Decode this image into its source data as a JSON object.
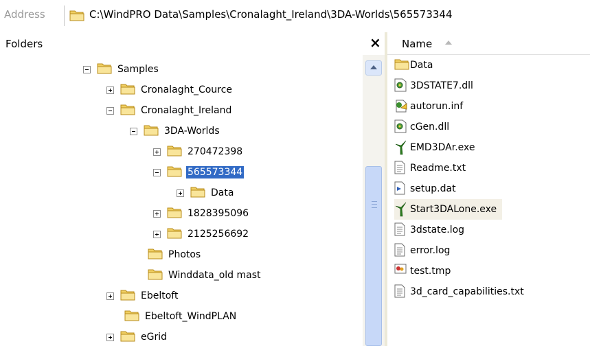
{
  "address": {
    "label": "Address",
    "path": "C:\\WindPRO Data\\Samples\\Cronalaght_Ireland\\3DA-Worlds\\565573344"
  },
  "folders_pane": {
    "title": "Folders",
    "close_glyph": "×"
  },
  "tree": {
    "samples": "Samples",
    "cronalaght_cource": "Cronalaght_Cource",
    "cronalaght_ireland": "Cronalaght_Ireland",
    "worlds": "3DA-Worlds",
    "n270": "270472398",
    "n565": "565573344",
    "data": "Data",
    "n1828": "1828395096",
    "n2125": "2125256692",
    "photos": "Photos",
    "winddata": "Winddata_old mast",
    "ebeltoft": "Ebeltoft",
    "ebeltoft_windplan": "Ebeltoft_WindPLAN",
    "egrid": "eGrid"
  },
  "list": {
    "column_name": "Name",
    "files": [
      {
        "name": "Data",
        "icon": "folder-icon"
      },
      {
        "name": "3DSTATE7.dll",
        "icon": "dll-icon"
      },
      {
        "name": "autorun.inf",
        "icon": "inf-icon"
      },
      {
        "name": "cGen.dll",
        "icon": "dll-icon"
      },
      {
        "name": "EMD3DAr.exe",
        "icon": "turbine-exe-icon"
      },
      {
        "name": "Readme.txt",
        "icon": "text-file-icon"
      },
      {
        "name": "setup.dat",
        "icon": "dat-file-icon"
      },
      {
        "name": "Start3DALone.exe",
        "icon": "turbine-exe-icon"
      },
      {
        "name": "3dstate.log",
        "icon": "text-file-icon"
      },
      {
        "name": "error.log",
        "icon": "text-file-icon"
      },
      {
        "name": "test.tmp",
        "icon": "tmp-file-icon"
      },
      {
        "name": "3d_card_capabilities.txt",
        "icon": "text-file-icon"
      }
    ]
  },
  "colors": {
    "selection": "#316ac5",
    "folder": "#f2d46b"
  }
}
